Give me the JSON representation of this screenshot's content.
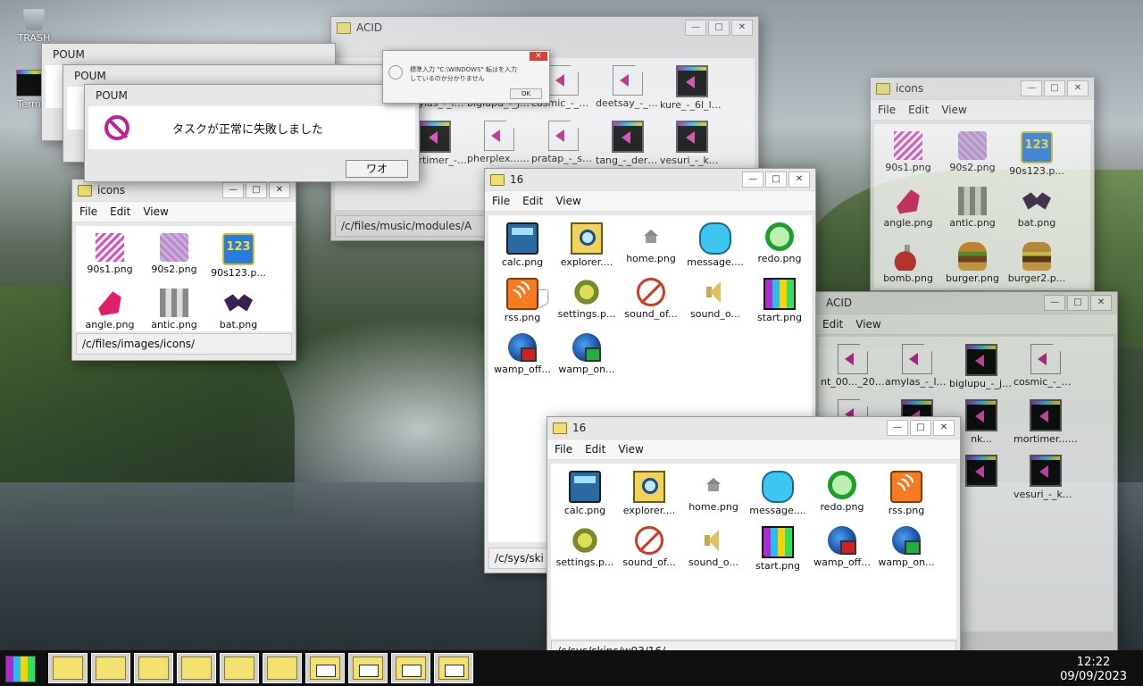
{
  "desktop": {
    "icons": [
      {
        "label": "TRASH",
        "icon": "trash-icon"
      },
      {
        "label": "Termi",
        "icon": "terminal-icon"
      }
    ]
  },
  "dialogs": {
    "poum_back1": {
      "title": "POUM"
    },
    "poum_back2": {
      "title": "POUM"
    },
    "poum_front": {
      "title": "POUM",
      "message": "タスクが正常に失敗しました",
      "button": "ワオ"
    },
    "error_popup": {
      "line1": "標準入力 \"C:\\WINDOWS\" 転はを入力",
      "line2": "しているのか分かりません",
      "button": "OK"
    }
  },
  "menu": {
    "file": "File",
    "edit": "Edit",
    "view": "View"
  },
  "window_buttons": {
    "minimize": "—",
    "maximize": "□",
    "close": "✕"
  },
  "acid_main": {
    "title": "ACID",
    "path": "/c/files/music/modules/A",
    "items": [
      {
        "label": "amylas_-_leak.xm",
        "icon": "sound-file-icon"
      },
      {
        "label": "biglupu_-_jack.mod",
        "icon": "sound-file-icon"
      },
      {
        "label": "cosmic_-_my_hou...",
        "icon": "sound-file-icon"
      },
      {
        "label": "deetsay_-_aidosti_f...",
        "icon": "sound-file-icon"
      },
      {
        "label": "kure_-_6l_lonke...",
        "icon": "terminal-icon"
      },
      {
        "label": "mortimer_-_the_prin...",
        "icon": "terminal-icon"
      },
      {
        "label": "pherplex..._noise_re...",
        "icon": "sound-file-icon"
      },
      {
        "label": "pratap_-_svokons...",
        "icon": "sound-file-icon"
      },
      {
        "label": "tang_-_derivatio...",
        "icon": "terminal-icon"
      },
      {
        "label": "vesuri_-_kulp.mod",
        "icon": "terminal-icon"
      }
    ]
  },
  "icons_left": {
    "title": "icons",
    "path": "/c/files/images/icons/",
    "items": [
      {
        "label": "90s1.png",
        "icon": "90s1-icon"
      },
      {
        "label": "90s2.png",
        "icon": "90s2-icon"
      },
      {
        "label": "90s123.p...",
        "icon": "90s123-icon"
      },
      {
        "label": "angle.png",
        "icon": "angle-icon"
      },
      {
        "label": "antic.png",
        "icon": "antic-icon"
      },
      {
        "label": "bat.png",
        "icon": "bat-icon"
      }
    ]
  },
  "icons_right": {
    "title": "icons",
    "items": [
      {
        "label": "90s1.png",
        "icon": "90s1-icon"
      },
      {
        "label": "90s2.png",
        "icon": "90s2-icon"
      },
      {
        "label": "90s123.p...",
        "icon": "90s123-icon"
      },
      {
        "label": "angle.png",
        "icon": "angle-icon"
      },
      {
        "label": "antic.png",
        "icon": "antic-icon"
      },
      {
        "label": "bat.png",
        "icon": "bat-icon"
      },
      {
        "label": "bomb.png",
        "icon": "bomb-icon"
      },
      {
        "label": "burger.png",
        "icon": "burger-icon"
      },
      {
        "label": "burger2.p...",
        "icon": "burger2-icon"
      }
    ]
  },
  "acid_right": {
    "title": "ACID",
    "items": [
      {
        "label": "nt_00..._20960...",
        "icon": "sound-file-icon"
      },
      {
        "label": "amylas_-_leak.xm",
        "icon": "sound-file-icon"
      },
      {
        "label": "biglupu_-_jack.mod",
        "icon": "terminal-icon"
      },
      {
        "label": "cosmic_-_my_hou...",
        "icon": "sound-file-icon"
      },
      {
        "label": "",
        "icon": "sound-file-icon"
      },
      {
        "label": "",
        "icon": "terminal-icon"
      },
      {
        "label": "nk...",
        "icon": "terminal-icon"
      },
      {
        "label": "mortimer..._the_prin...",
        "icon": "terminal-icon"
      },
      {
        "label": "",
        "icon": "sound-file-icon"
      },
      {
        "label": "o...",
        "icon": "terminal-icon"
      },
      {
        "label": "",
        "icon": "terminal-icon"
      },
      {
        "label": "vesuri_-_kulp.mod",
        "icon": "terminal-icon"
      }
    ]
  },
  "win16_a": {
    "title": "16",
    "path": "/c/sys/ski",
    "items": [
      {
        "label": "calc.png",
        "icon": "calculator-icon"
      },
      {
        "label": "explorer....",
        "icon": "explorer-icon"
      },
      {
        "label": "home.png",
        "icon": "home-icon"
      },
      {
        "label": "message....",
        "icon": "message-icon"
      },
      {
        "label": "redo.png",
        "icon": "redo-icon"
      },
      {
        "label": "rss.png",
        "icon": "rss-icon"
      },
      {
        "label": "settings.p...",
        "icon": "settings-icon"
      },
      {
        "label": "sound_of...",
        "icon": "sound-off-icon"
      },
      {
        "label": "sound_o...",
        "icon": "sound-on-icon"
      },
      {
        "label": "start.png",
        "icon": "start-icon"
      },
      {
        "label": "wamp_off...",
        "icon": "wamp-off-icon"
      },
      {
        "label": "wamp_on...",
        "icon": "wamp-on-icon"
      }
    ]
  },
  "win16_b": {
    "title": "16",
    "path": "/c/sys/skins/w93/16/",
    "items": [
      {
        "label": "calc.png",
        "icon": "calculator-icon"
      },
      {
        "label": "explorer....",
        "icon": "explorer-icon"
      },
      {
        "label": "home.png",
        "icon": "home-icon"
      },
      {
        "label": "message....",
        "icon": "message-icon"
      },
      {
        "label": "redo.png",
        "icon": "redo-icon"
      },
      {
        "label": "rss.png",
        "icon": "rss-icon"
      },
      {
        "label": "settings.p...",
        "icon": "settings-icon"
      },
      {
        "label": "sound_of...",
        "icon": "sound-off-icon"
      },
      {
        "label": "sound_o...",
        "icon": "sound-on-icon"
      },
      {
        "label": "start.png",
        "icon": "start-icon"
      },
      {
        "label": "wamp_off...",
        "icon": "wamp-off-icon"
      },
      {
        "label": "wamp_on...",
        "icon": "wamp-on-icon"
      }
    ]
  },
  "taskbar": {
    "buttons": [
      "folder-icon",
      "folder-icon",
      "folder-icon",
      "folder-icon",
      "folder-icon",
      "folder-icon",
      "app-window-icon",
      "app-window-icon",
      "app-window-icon",
      "app-window-icon"
    ],
    "time": "12:22",
    "date": "09/09/2023"
  }
}
